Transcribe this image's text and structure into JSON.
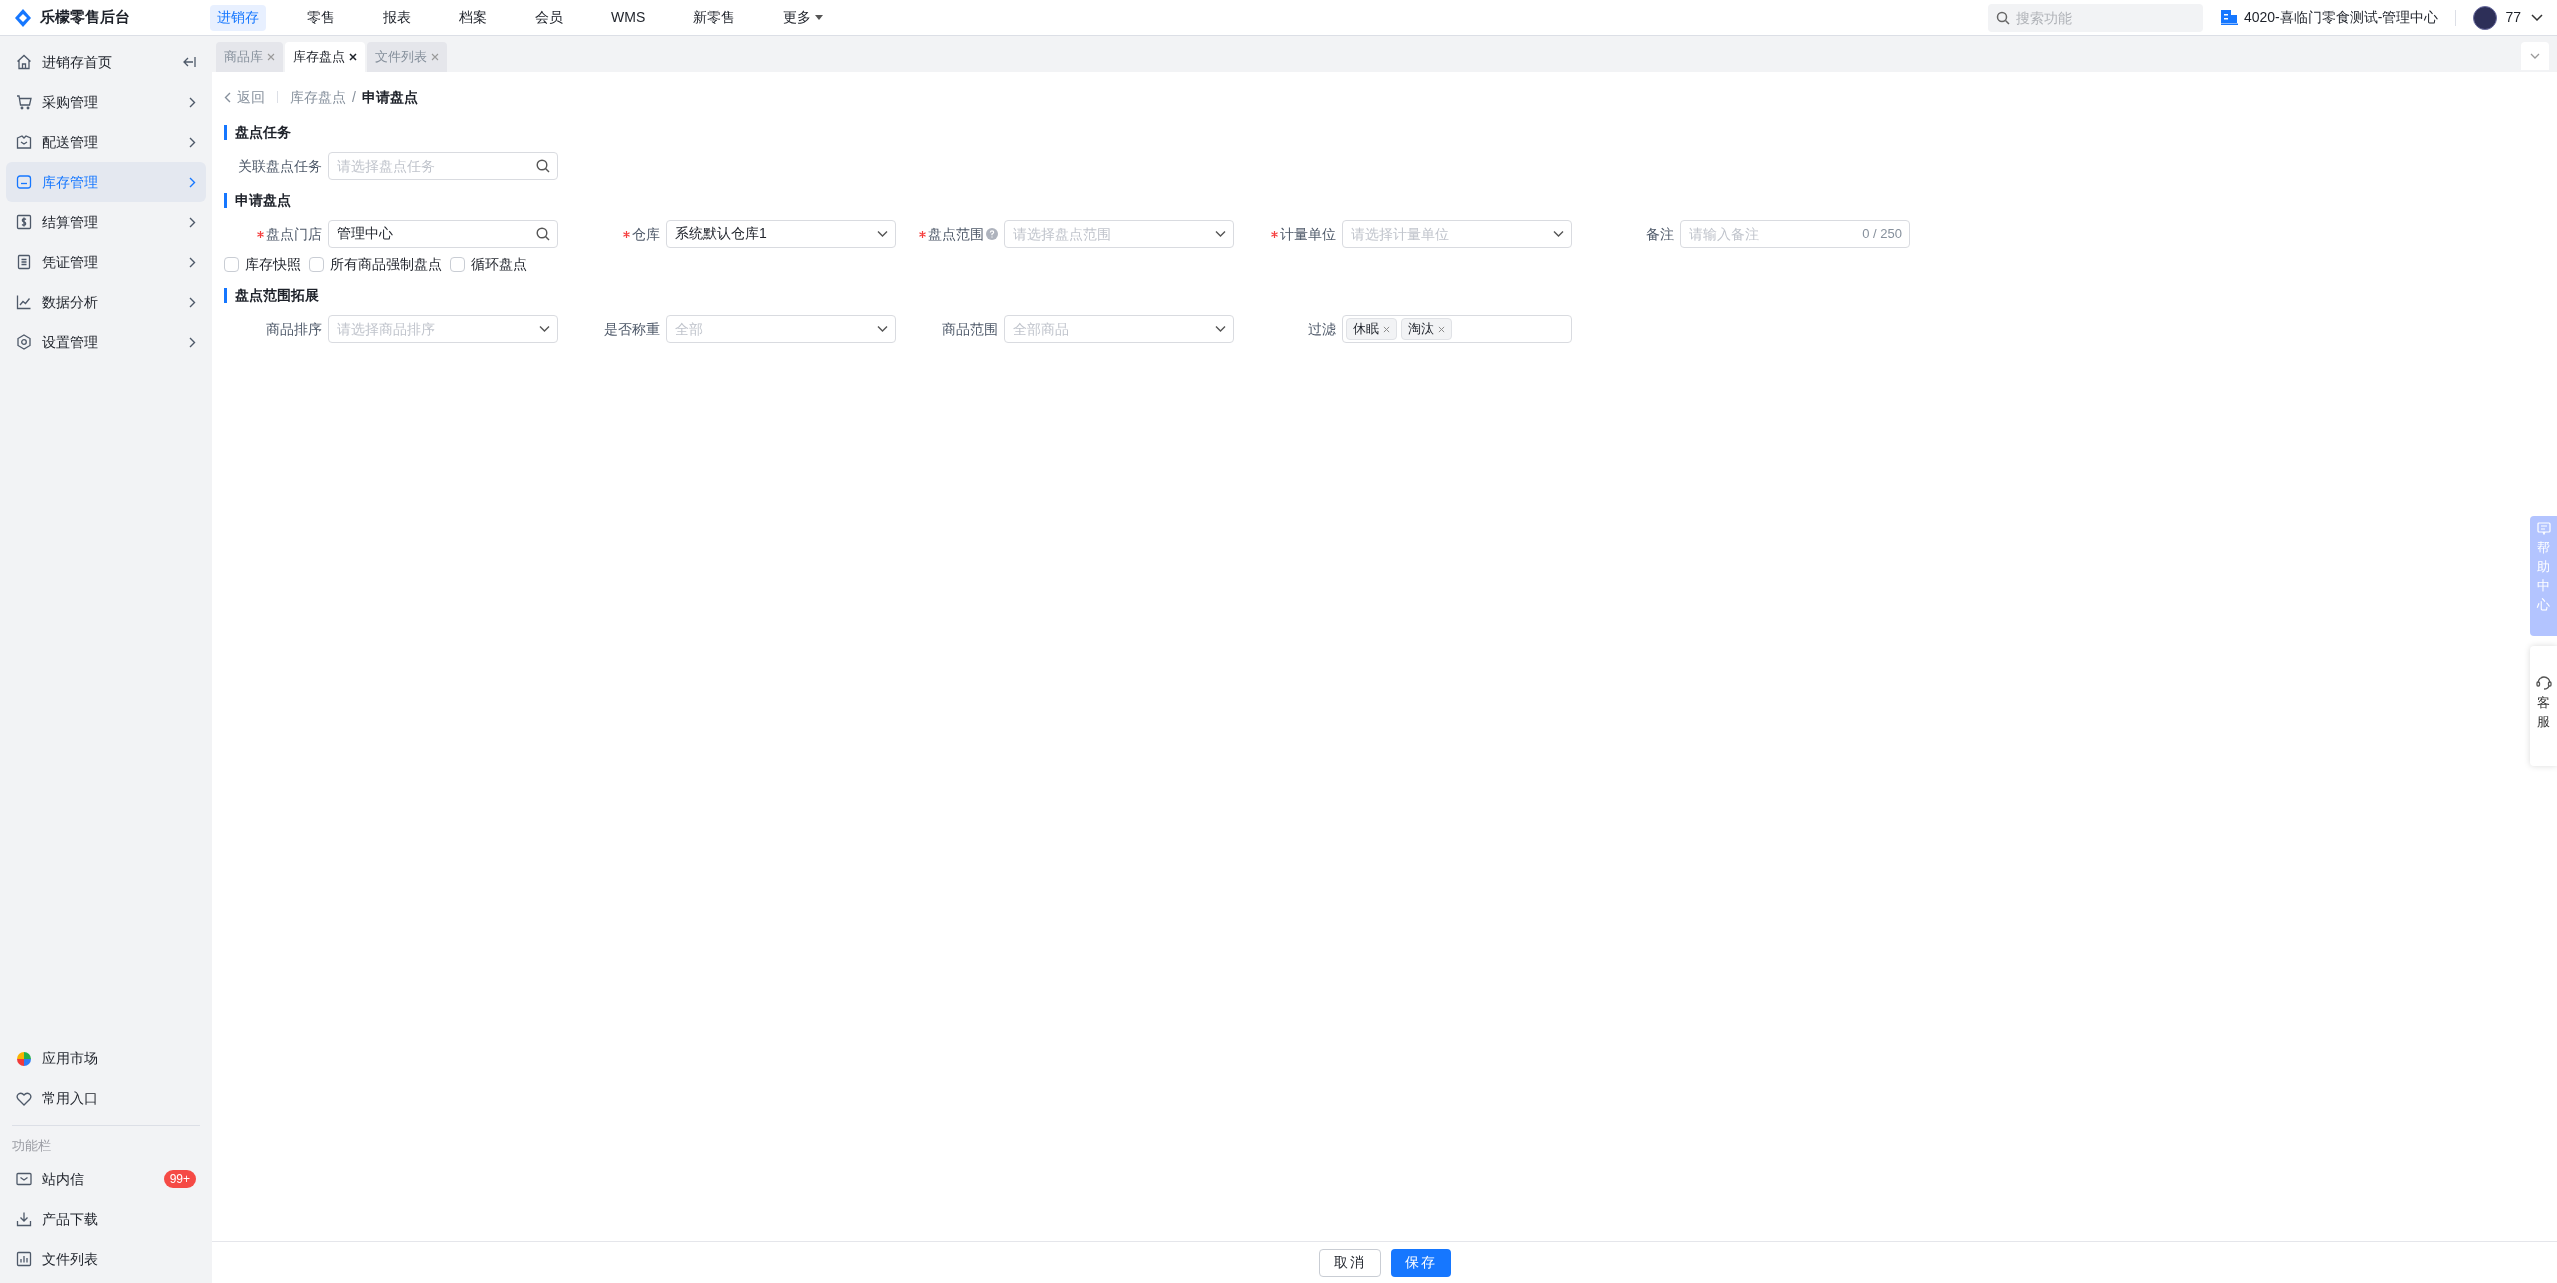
{
  "app": {
    "title": "乐檬零售后台"
  },
  "nav": [
    {
      "label": "进销存",
      "selected": true
    },
    {
      "label": "零售",
      "selected": false
    },
    {
      "label": "报表",
      "selected": false
    },
    {
      "label": "档案",
      "selected": false
    },
    {
      "label": "会员",
      "selected": false
    },
    {
      "label": "WMS",
      "selected": false
    },
    {
      "label": "新零售",
      "selected": false
    },
    {
      "label": "更多",
      "selected": false,
      "dropdown": true
    }
  ],
  "header": {
    "search": {
      "placeholder": "搜索功能"
    },
    "organization": "4020-喜临门零食测试-管理中心",
    "user": "77"
  },
  "sidebar": {
    "items": [
      {
        "label": "进销存首页",
        "kind": "collapse",
        "selected": false
      },
      {
        "label": "采购管理",
        "kind": "submenu",
        "selected": false
      },
      {
        "label": "配送管理",
        "kind": "submenu",
        "selected": false
      },
      {
        "label": "库存管理",
        "kind": "submenu",
        "selected": true
      },
      {
        "label": "结算管理",
        "kind": "submenu",
        "selected": false
      },
      {
        "label": "凭证管理",
        "kind": "submenu",
        "selected": false
      },
      {
        "label": "数据分析",
        "kind": "submenu",
        "selected": false
      },
      {
        "label": "设置管理",
        "kind": "submenu",
        "selected": false
      }
    ],
    "shortcuts": [
      {
        "label": "应用市场"
      },
      {
        "label": "常用入口"
      }
    ],
    "section_title": "功能栏",
    "tools": [
      {
        "label": "站内信",
        "badge": "99+"
      },
      {
        "label": "产品下载"
      },
      {
        "label": "文件列表"
      }
    ]
  },
  "tabs": [
    {
      "label": "商品库",
      "selected": false
    },
    {
      "label": "库存盘点",
      "selected": true
    },
    {
      "label": "文件列表",
      "selected": false
    }
  ],
  "breadcrumb": {
    "back": "返回",
    "separator": "/",
    "path": [
      "库存盘点",
      "申请盘点"
    ]
  },
  "sections": [
    {
      "title": "盘点任务",
      "fields": [
        {
          "label": "关联盘点任务",
          "kind": "search",
          "required": false,
          "placeholder": "请选择盘点任务"
        }
      ]
    },
    {
      "title": "申请盘点",
      "fields": [
        {
          "label": "盘点门店",
          "kind": "search",
          "required": true,
          "value": "管理中心"
        },
        {
          "label": "仓库",
          "kind": "select",
          "required": true,
          "value": "系统默认仓库1"
        },
        {
          "label": "盘点范围",
          "kind": "select",
          "required": true,
          "help": true,
          "placeholder": "请选择盘点范围"
        },
        {
          "label": "计量单位",
          "kind": "select",
          "required": true,
          "placeholder": "请选择计量单位"
        },
        {
          "label": "备注",
          "kind": "text",
          "required": false,
          "placeholder": "请输入备注",
          "counter": "0 / 250"
        }
      ],
      "checkboxes": [
        {
          "label": "库存快照",
          "checked": false
        },
        {
          "label": "所有商品强制盘点",
          "checked": false
        },
        {
          "label": "循环盘点",
          "checked": false
        }
      ]
    },
    {
      "title": "盘点范围拓展",
      "fields": [
        {
          "label": "商品排序",
          "kind": "select",
          "required": false,
          "placeholder": "请选择商品排序"
        },
        {
          "label": "是否称重",
          "kind": "select",
          "required": false,
          "placeholder": "全部"
        },
        {
          "label": "商品范围",
          "kind": "select",
          "required": false,
          "placeholder": "全部商品"
        },
        {
          "label": "过滤",
          "kind": "tags",
          "required": false,
          "tags": [
            "休眠",
            "淘汰"
          ]
        }
      ]
    }
  ],
  "footer": {
    "buttons": [
      {
        "label": "取消",
        "kind": "secondary"
      },
      {
        "label": "保存",
        "kind": "primary"
      }
    ]
  },
  "floating": {
    "help": "帮助中心",
    "service": "客服"
  }
}
